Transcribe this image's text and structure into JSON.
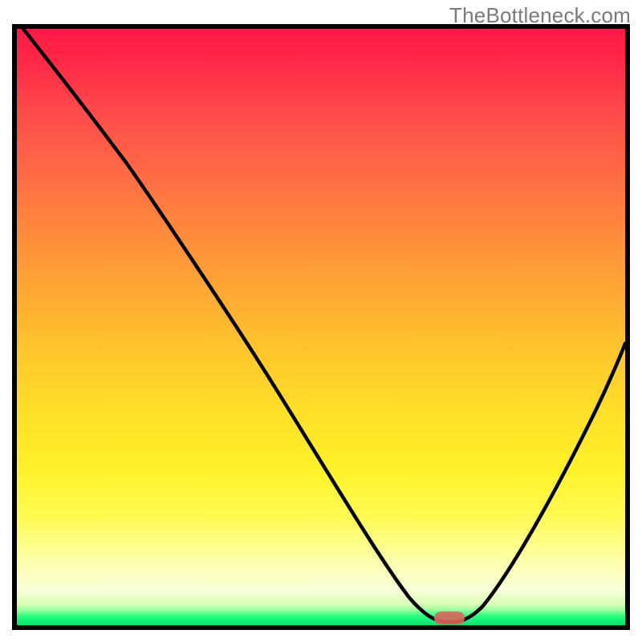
{
  "watermark": "TheBottleneck.com",
  "chart_data": {
    "type": "line",
    "title": "",
    "xlabel": "",
    "ylabel": "",
    "xlim": [
      0,
      100
    ],
    "ylim": [
      0,
      100
    ],
    "axes_visible": false,
    "background_gradient": [
      "#ff1a46",
      "#ff8a3c",
      "#ffdf29",
      "#fdffa8",
      "#00e472"
    ],
    "series": [
      {
        "name": "bottleneck-curve",
        "x": [
          1,
          8,
          16,
          24,
          32,
          40,
          48,
          56,
          62,
          66,
          69,
          72,
          76,
          80,
          85,
          90,
          95,
          100
        ],
        "y": [
          100,
          90,
          79,
          70,
          58,
          46,
          35,
          22,
          12,
          5,
          1,
          0,
          2,
          8,
          18,
          30,
          43,
          56
        ]
      }
    ],
    "marker": {
      "name": "optimal-point",
      "x": 71,
      "y": 0,
      "shape": "rounded-rect",
      "color": "#d9675b"
    }
  }
}
